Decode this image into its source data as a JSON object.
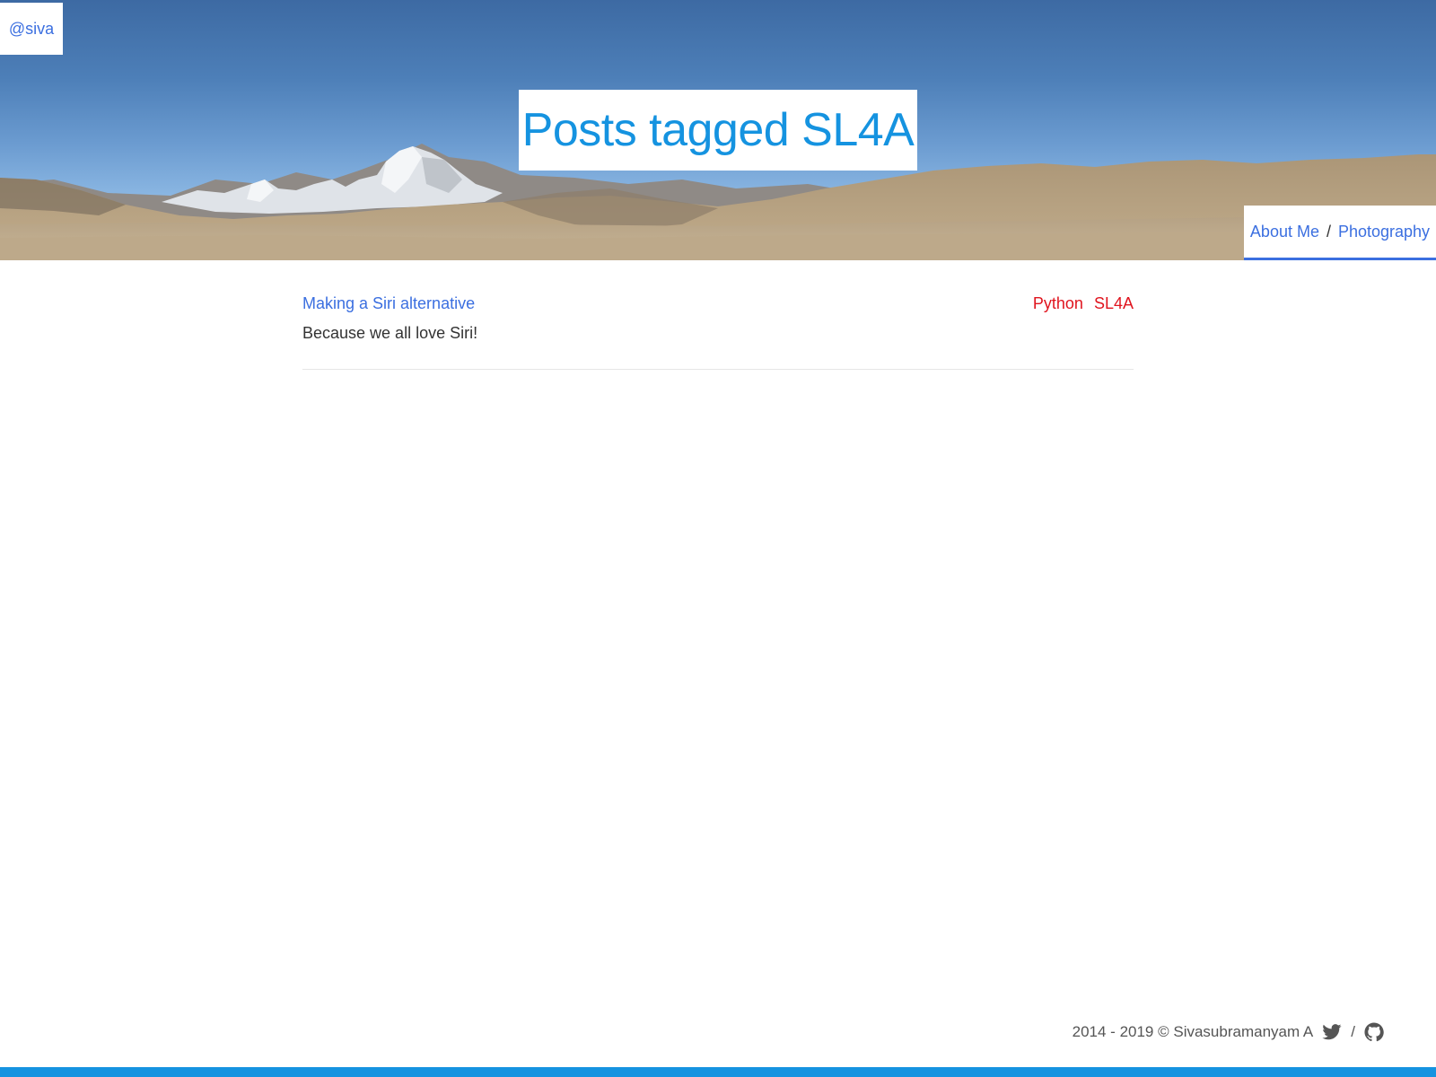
{
  "header": {
    "handle": "@siva",
    "title": "Posts tagged SL4A",
    "nav": [
      {
        "label": "About Me"
      },
      {
        "label": "Photography"
      }
    ],
    "nav_separator": "/"
  },
  "posts": [
    {
      "title": "Making a Siri alternative",
      "excerpt": "Because we all love Siri!",
      "tags": [
        "Python",
        "SL4A"
      ]
    }
  ],
  "footer": {
    "copyright": "2014 - 2019 © Sivasubramanyam A",
    "separator": "/",
    "icons": [
      "twitter-icon",
      "github-icon"
    ]
  },
  "colors": {
    "link": "#3b6fe0",
    "title": "#1593e0",
    "tag": "#e0141e",
    "accent_bar": "#1593e0"
  }
}
